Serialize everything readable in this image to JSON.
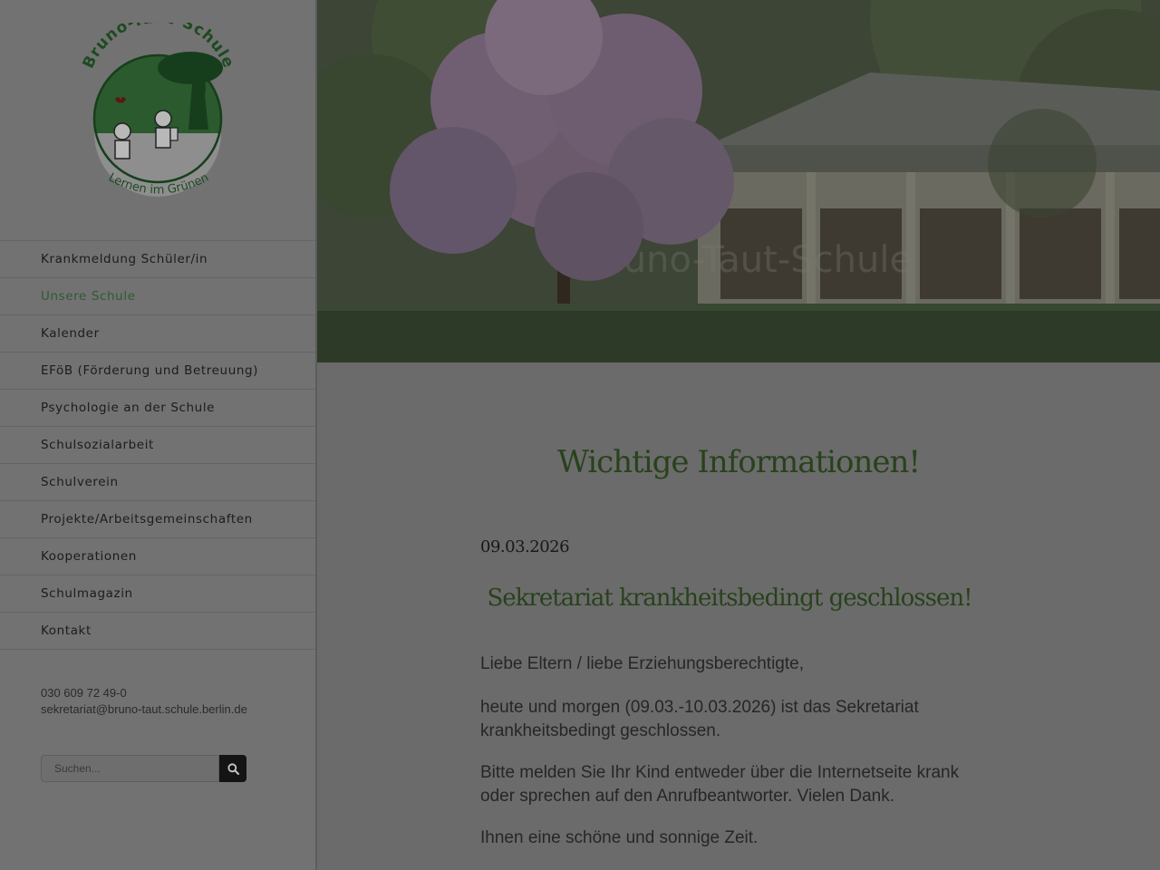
{
  "logo": {
    "school_name": "Bruno-Taut-Schule",
    "motto": "Lernen im Grünen"
  },
  "nav": {
    "items": [
      {
        "label": "Krankmeldung Schüler/in"
      },
      {
        "label": "Unsere Schule"
      },
      {
        "label": "Kalender"
      },
      {
        "label": "EFöB (Förderung und Betreuung)"
      },
      {
        "label": "Psychologie an der Schule"
      },
      {
        "label": "Schulsozialarbeit"
      },
      {
        "label": "Schulverein"
      },
      {
        "label": "Projekte/Arbeitsgemeinschaften"
      },
      {
        "label": "Kooperationen"
      },
      {
        "label": "Schulmagazin"
      },
      {
        "label": "Kontakt"
      }
    ],
    "active_item": "Unsere Schule"
  },
  "contact": {
    "phone": "030 609 72 49-0",
    "email": "sekretariat@bruno-taut.schule.berlin.de"
  },
  "search": {
    "placeholder": "Suchen...",
    "button_icon": "search-icon"
  },
  "hero": {
    "watermark_text": "Bruno-Taut-Schule"
  },
  "main": {
    "title": "Wichtige Informationen!",
    "post": {
      "date": "09.03.2026",
      "headline": "Sekretariat krankheitsbedingt geschlossen!",
      "paragraphs": [
        "Liebe Eltern / liebe Erziehungsberechtigte,",
        "heute und morgen (09.03.-10.03.2026) ist das Sekretariat krankheitsbedingt geschlossen.",
        "Bitte melden Sie Ihr Kind entweder über die Internetseite krank oder sprechen auf den Anrufbeantworter. Vielen Dank.",
        "Ihnen eine schöne und sonnige Zeit."
      ]
    }
  },
  "colors": {
    "accent_green": "#28421c",
    "active_nav": "#2e5a34",
    "overlay": "#6b6b6b"
  }
}
